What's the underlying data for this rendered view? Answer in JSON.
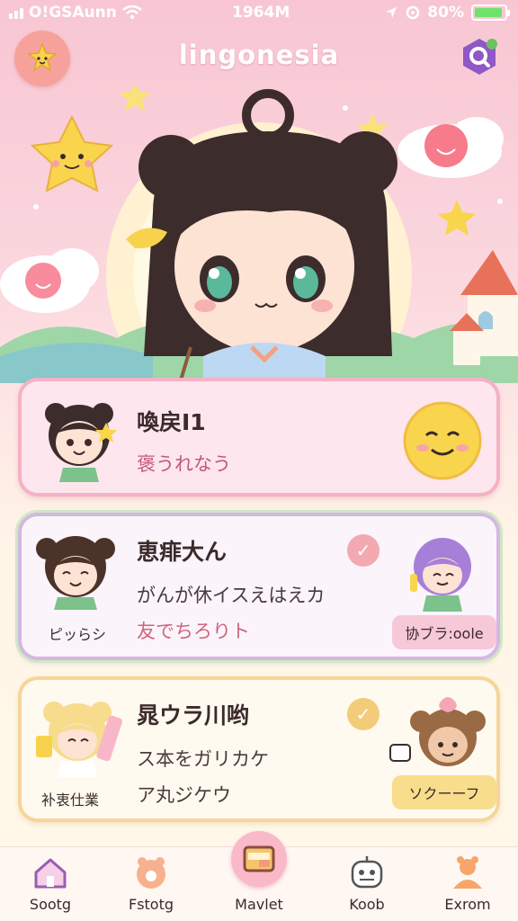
{
  "status_bar": {
    "carrier": "O!GSAunn",
    "time": "1964M",
    "battery_text": "80%"
  },
  "header": {
    "title": "lingonesia",
    "left_icon": "character-icon",
    "right_icon": "search-icon"
  },
  "cards": [
    {
      "title": "喚戻I1",
      "subtitle": "褒うれなう",
      "icon": "smiley-sun-icon"
    },
    {
      "title": "恵痱大ん",
      "subtitle": "がんが休イスえはえカ",
      "subtitle2": "友でちろりト",
      "name_label": "ピッらシ",
      "tag": "协ブラ:oole",
      "checked": true
    },
    {
      "title": "晁ウラ川哟",
      "subtitle": "ス本をガリカケ",
      "subtitle2": "ア丸ジケウ",
      "name_label": "补衷仕業",
      "tag": "ソクーーフ",
      "checked": true
    }
  ],
  "tabs": [
    {
      "label": "Sootg",
      "icon": "home-icon"
    },
    {
      "label": "Fstotg",
      "icon": "pet-icon"
    },
    {
      "label": "Mavlet",
      "icon": "wallet-icon",
      "active": true
    },
    {
      "label": "Koob",
      "icon": "robot-icon"
    },
    {
      "label": "Exrom",
      "icon": "profile-icon"
    }
  ],
  "colors": {
    "accent_pink": "#f9b9c9",
    "battery_green": "#6fe26a"
  }
}
